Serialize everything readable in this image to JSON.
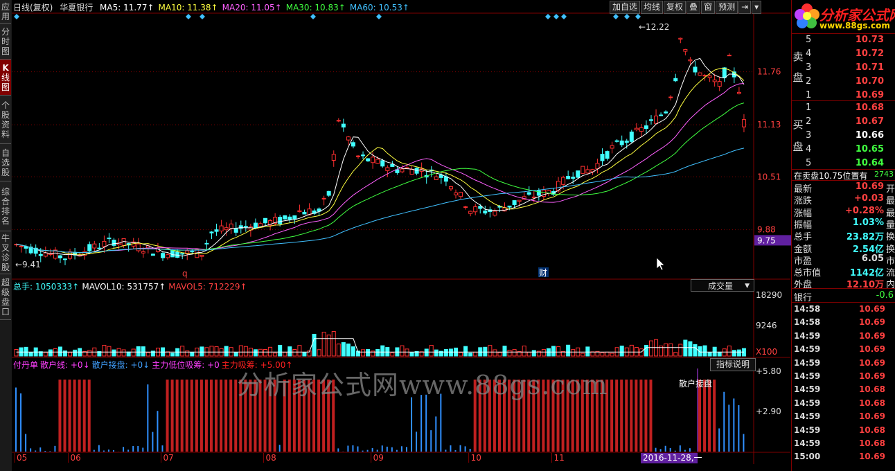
{
  "left_nav": [
    {
      "lines": [
        "应",
        "用"
      ],
      "active": false
    },
    {
      "lines": [
        "分",
        "时",
        "图"
      ],
      "active": false
    },
    {
      "lines": [
        "K",
        "线",
        "图"
      ],
      "active": true
    },
    {
      "lines": [
        "个",
        "股",
        "资",
        "料"
      ],
      "active": false
    },
    {
      "lines": [
        "自",
        "选",
        "股"
      ],
      "active": false
    },
    {
      "lines": [
        "综",
        "合",
        "排",
        "名"
      ],
      "active": false
    },
    {
      "lines": [
        "牛",
        "叉",
        "诊",
        "股"
      ],
      "active": false
    },
    {
      "lines": [
        "超",
        "级",
        "盘",
        "口"
      ],
      "active": false
    }
  ],
  "header": {
    "period": "日线(复权)",
    "stock": "华夏银行",
    "ma": [
      {
        "label": "MA5: 11.77↑",
        "color": "#ffffff"
      },
      {
        "label": "MA10: 11.38↑",
        "color": "#ffff40"
      },
      {
        "label": "MA20: 11.05↑",
        "color": "#ff60ff"
      },
      {
        "label": "MA30: 10.83↑",
        "color": "#40ff40"
      },
      {
        "label": "MA60: 10.53↑",
        "color": "#40c0ff"
      }
    ]
  },
  "toolbar": [
    "加自选",
    "均线",
    "复权",
    "叠",
    "窗",
    "预测",
    "⇥",
    "▾"
  ],
  "price_axis": [
    {
      "label": "11.76",
      "value": 11.76
    },
    {
      "label": "11.13",
      "value": 11.13
    },
    {
      "label": "10.51",
      "value": 10.51
    },
    {
      "label": "9.88",
      "value": 9.88
    }
  ],
  "price_range": {
    "min": 9.3,
    "max": 12.45
  },
  "price_marker": {
    "label": "9.75",
    "value": 9.75
  },
  "annotations": {
    "high": "12.22",
    "low": "9.41",
    "mark_q": "q",
    "mark_cai": "财"
  },
  "volume": {
    "legend": [
      {
        "label": "总手: 1050333↑",
        "color": "#40ffff"
      },
      {
        "label": "MAVOL10: 531757↑",
        "color": "#ffffff"
      },
      {
        "label": "MAVOL5: 712229↑",
        "color": "#ff4040"
      }
    ],
    "selector": "成交量",
    "axis": [
      "18290",
      "9246",
      "X100"
    ]
  },
  "indicator": {
    "legend": [
      {
        "label": "付丹单",
        "color": "#ff40ff"
      },
      {
        "label": "散户线: +0↓",
        "color": "#ff40ff"
      },
      {
        "label": "散户接盘: +0↓",
        "color": "#40a0ff"
      },
      {
        "label": "主力低位吸筹: +0",
        "color": "#ff40ff"
      },
      {
        "label": "主力吸筹: +5.00↑",
        "color": "#ff2020"
      }
    ],
    "button": "指标说明",
    "axis": [
      "+5.80",
      "+2.90"
    ],
    "side_label": "散户接盘"
  },
  "watermark": "分析家公式网www.88gs.com",
  "x_axis": {
    "months": [
      "05",
      "06",
      "07",
      "08",
      "09",
      "10",
      "11"
    ],
    "cursor_date": "2016-11-28,一"
  },
  "logo": {
    "title": "分析家公式网",
    "url": "www.88gs.com"
  },
  "orderbook": {
    "sell_label": [
      "卖",
      "盘"
    ],
    "buy_label": [
      "买",
      "盘"
    ],
    "sell": [
      {
        "level": "5",
        "price": "10.73"
      },
      {
        "level": "4",
        "price": "10.72"
      },
      {
        "level": "3",
        "price": "10.71"
      },
      {
        "level": "2",
        "price": "10.70"
      },
      {
        "level": "1",
        "price": "10.69"
      }
    ],
    "buy": [
      {
        "level": "1",
        "price": "10.68"
      },
      {
        "level": "2",
        "price": "10.67"
      },
      {
        "level": "3",
        "price": "10.66"
      },
      {
        "level": "4",
        "price": "10.65"
      },
      {
        "level": "5",
        "price": "10.64"
      }
    ],
    "buy_colors": [
      "#ff4040",
      "#ff4040",
      "#ffffff",
      "#40ff40",
      "#40ff40"
    ],
    "status": "在卖盘10.75位置有",
    "status_value": "2743"
  },
  "quote": [
    {
      "key": "最新",
      "value": "10.69",
      "tail": "开",
      "color": "#ff4040"
    },
    {
      "key": "涨跌",
      "value": "+0.03",
      "tail": "最",
      "color": "#ff4040"
    },
    {
      "key": "涨幅",
      "value": "+0.28%",
      "tail": "最",
      "color": "#ff4040"
    },
    {
      "key": "振幅",
      "value": "1.03%",
      "tail": "量",
      "color": "#40ffff"
    },
    {
      "key": "总手",
      "value": "23.82万",
      "tail": "换",
      "color": "#40ffff"
    },
    {
      "key": "金额",
      "value": "2.54亿",
      "tail": "换",
      "color": "#40ffff"
    },
    {
      "key": "市盈",
      "value": "6.05",
      "tail": "市",
      "color": "#dddddd"
    },
    {
      "key": "总市值",
      "value": "1142亿",
      "tail": "流",
      "color": "#40ffff"
    },
    {
      "key": "外盘",
      "value": "12.10万",
      "tail": "内",
      "color": "#ff4040"
    }
  ],
  "sector": {
    "name": "银行",
    "change": "-0.6"
  },
  "ticks": [
    {
      "time": "14:58",
      "price": "10.69"
    },
    {
      "time": "14:58",
      "price": "10.69"
    },
    {
      "time": "14:59",
      "price": "10.69"
    },
    {
      "time": "14:59",
      "price": "10.69"
    },
    {
      "time": "14:59",
      "price": "10.69"
    },
    {
      "time": "14:59",
      "price": "10.69"
    },
    {
      "time": "14:59",
      "price": "10.68"
    },
    {
      "time": "14:59",
      "price": "10.68"
    },
    {
      "time": "14:59",
      "price": "10.69"
    },
    {
      "time": "14:59",
      "price": "10.68"
    },
    {
      "time": "14:59",
      "price": "10.68"
    },
    {
      "time": "15:00",
      "price": "10.69"
    }
  ]
}
